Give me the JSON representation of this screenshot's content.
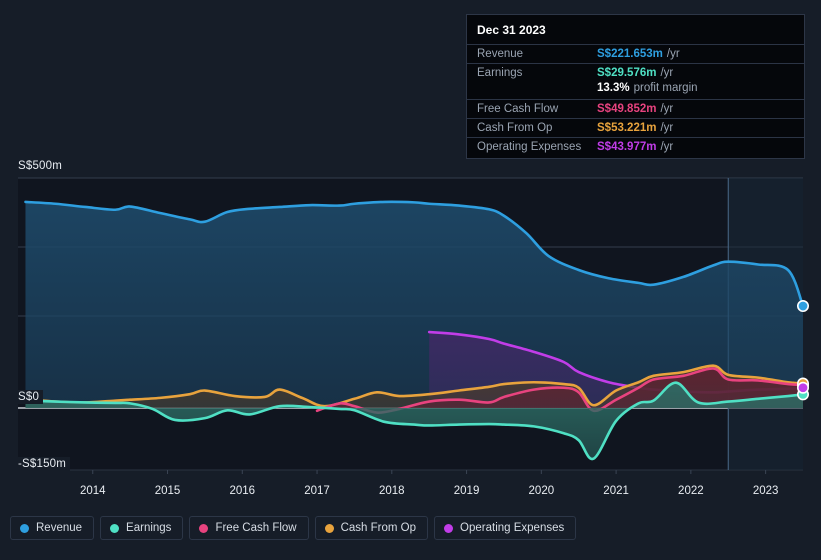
{
  "axis": {
    "y_top_label": "S$500m",
    "y_zero_label": "S$0",
    "y_bottom_label": "-S$150m",
    "x_ticks": [
      "2014",
      "2015",
      "2016",
      "2017",
      "2018",
      "2019",
      "2020",
      "2021",
      "2022",
      "2023"
    ]
  },
  "tooltip": {
    "date": "Dec 31 2023",
    "rows": [
      {
        "key": "Revenue",
        "value": "S$221.653m",
        "suffix": "/yr",
        "color": "#2e9fe0"
      },
      {
        "key": "Earnings",
        "value": "S$29.576m",
        "suffix": "/yr",
        "color": "#4fe0c4"
      },
      {
        "key": "",
        "value": "13.3%",
        "suffix": "profit margin",
        "color": "#ffffff"
      },
      {
        "key": "Free Cash Flow",
        "value": "S$49.852m",
        "suffix": "/yr",
        "color": "#e8437f"
      },
      {
        "key": "Cash From Op",
        "value": "S$53.221m",
        "suffix": "/yr",
        "color": "#e8a33d"
      },
      {
        "key": "Operating Expenses",
        "value": "S$43.977m",
        "suffix": "/yr",
        "color": "#c13de8"
      }
    ]
  },
  "legend": [
    {
      "label": "Revenue",
      "color": "#2e9fe0"
    },
    {
      "label": "Earnings",
      "color": "#4fe0c4"
    },
    {
      "label": "Free Cash Flow",
      "color": "#e8437f"
    },
    {
      "label": "Cash From Op",
      "color": "#e8a33d"
    },
    {
      "label": "Operating Expenses",
      "color": "#c13de8"
    }
  ],
  "chart_data": {
    "type": "area",
    "title": "",
    "xlabel": "",
    "ylabel": "S$",
    "ylim": [
      -150,
      500
    ],
    "grid": true,
    "legend_position": "bottom",
    "currency": "S$",
    "unit": "m",
    "x_range": [
      2013.5,
      2024.0
    ],
    "gridline_values": [
      500,
      350,
      200,
      0
    ],
    "forecast_divider_x": 2023.0,
    "series": [
      {
        "name": "Revenue",
        "color": "#2e9fe0",
        "fill": "#1d4766",
        "x": [
          2013.6,
          2014.0,
          2014.4,
          2014.8,
          2015.0,
          2015.4,
          2015.8,
          2016.0,
          2016.3,
          2016.6,
          2017.0,
          2017.4,
          2017.8,
          2018.0,
          2018.4,
          2018.8,
          2019.0,
          2019.4,
          2019.8,
          2020.0,
          2020.3,
          2020.6,
          2021.0,
          2021.4,
          2021.8,
          2022.0,
          2022.4,
          2022.8,
          2023.0,
          2023.4,
          2023.8,
          2024.0
        ],
        "values": [
          448,
          444,
          437,
          431,
          438,
          424,
          410,
          405,
          426,
          433,
          437,
          441,
          440,
          444,
          448,
          447,
          444,
          440,
          432,
          418,
          380,
          330,
          300,
          282,
          272,
          268,
          285,
          310,
          318,
          312,
          300,
          221.653
        ]
      },
      {
        "name": "Earnings",
        "color": "#4fe0c4",
        "fill": "#2c6a63",
        "x": [
          2013.6,
          2014.0,
          2014.4,
          2014.8,
          2015.0,
          2015.3,
          2015.6,
          2016.0,
          2016.3,
          2016.6,
          2017.0,
          2017.4,
          2017.8,
          2018.0,
          2018.4,
          2018.8,
          2019.0,
          2019.4,
          2019.8,
          2020.0,
          2020.4,
          2020.8,
          2021.0,
          2021.2,
          2021.5,
          2021.8,
          2022.0,
          2022.3,
          2022.6,
          2023.0,
          2023.4,
          2023.8,
          2024.0
        ],
        "values": [
          16,
          14,
          12,
          11,
          10,
          -2,
          -26,
          -22,
          -5,
          -14,
          4,
          2,
          -2,
          -5,
          -30,
          -36,
          -38,
          -36,
          -35,
          -36,
          -40,
          -55,
          -70,
          -110,
          -28,
          10,
          16,
          55,
          12,
          14,
          20,
          26,
          29.576
        ]
      },
      {
        "name": "Free Cash Flow",
        "color": "#e8437f",
        "fill": "#5c2233",
        "x": [
          2017.5,
          2017.8,
          2018.0,
          2018.3,
          2018.6,
          2019.0,
          2019.4,
          2019.8,
          2020.0,
          2020.4,
          2020.8,
          2021.0,
          2021.2,
          2021.5,
          2021.8,
          2022.0,
          2022.4,
          2022.8,
          2023.0,
          2023.4,
          2023.8,
          2024.0
        ],
        "values": [
          -6,
          10,
          4,
          -10,
          -2,
          14,
          18,
          12,
          24,
          40,
          44,
          34,
          -6,
          18,
          44,
          62,
          70,
          86,
          62,
          60,
          52,
          49.852
        ]
      },
      {
        "name": "Cash From Op",
        "color": "#e8a33d",
        "fill": "#4b3b2a",
        "x": [
          2013.6,
          2014.0,
          2014.4,
          2014.8,
          2015.0,
          2015.4,
          2015.8,
          2016.0,
          2016.4,
          2016.8,
          2017.0,
          2017.3,
          2017.6,
          2018.0,
          2018.3,
          2018.6,
          2019.0,
          2019.4,
          2019.8,
          2020.0,
          2020.4,
          2020.8,
          2021.0,
          2021.2,
          2021.5,
          2021.8,
          2022.0,
          2022.4,
          2022.8,
          2023.0,
          2023.4,
          2023.8,
          2024.0
        ],
        "values": [
          20,
          14,
          12,
          16,
          18,
          22,
          30,
          38,
          26,
          24,
          40,
          22,
          4,
          20,
          34,
          26,
          30,
          38,
          46,
          52,
          56,
          52,
          44,
          6,
          38,
          56,
          70,
          78,
          92,
          72,
          66,
          56,
          53.221
        ]
      },
      {
        "name": "Operating Expenses",
        "color": "#c13de8",
        "fill": "#3d2a63",
        "x": [
          2019.0,
          2019.4,
          2019.8,
          2020.0,
          2020.4,
          2020.8,
          2021.0,
          2021.4,
          2021.8,
          2022.0,
          2022.4,
          2022.8,
          2023.0,
          2023.4,
          2023.8,
          2024.0
        ],
        "values": [
          165,
          160,
          150,
          140,
          122,
          100,
          78,
          56,
          44,
          40,
          36,
          34,
          36,
          40,
          42,
          43.977
        ]
      }
    ]
  }
}
